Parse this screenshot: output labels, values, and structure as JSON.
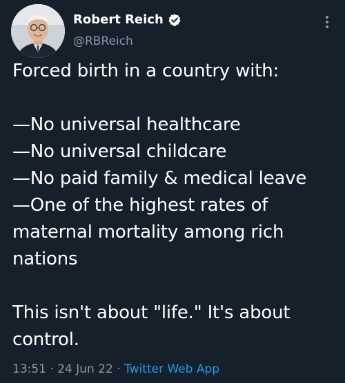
{
  "tweet": {
    "author": {
      "display_name": "Robert Reich",
      "handle": "@RBReich",
      "verified": true
    },
    "text": "Forced birth in a country with:\n\n—No universal healthcare\n—No universal childcare\n—No paid family & medical leave\n—One of the highest rates of maternal mortality among rich nations\n\nThis isn't about \"life.\" It's about control.",
    "time": "13:51",
    "separator": "·",
    "date": "24 Jun 22",
    "source": "Twitter Web App"
  },
  "icons": {
    "verified": "verified-badge-icon",
    "more": "more-options-icon"
  },
  "colors": {
    "background": "#15202b",
    "text_primary": "#ffffff",
    "text_secondary": "#8b98a5",
    "accent": "#1d9bf0"
  }
}
